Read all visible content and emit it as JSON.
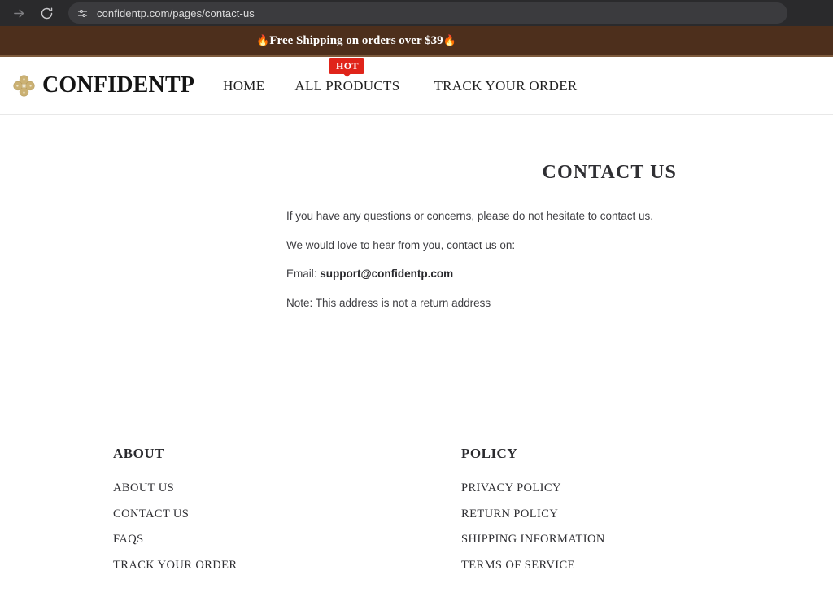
{
  "browser": {
    "forward_icon": "forward-arrow-icon",
    "reload_icon": "reload-icon",
    "omnibox": {
      "tune_icon": "tune-sliders-icon",
      "url": "confidentp.com/pages/contact-us"
    }
  },
  "announcement": {
    "flame_left": "🔥",
    "text": "Free Shipping on orders over $39",
    "flame_right": "🔥",
    "background_color": "#4d2f1c",
    "text_color": "#ffffff"
  },
  "header": {
    "logo": {
      "mark_icon": "quatrefoil-flower-logo-icon",
      "mark_color": "#cbb173",
      "name": "CONFIDENTP"
    },
    "nav": [
      {
        "label": "HOME"
      },
      {
        "label": "ALL PRODUCTS",
        "badge": "HOT",
        "badge_color": "#e0241a"
      },
      {
        "label": "TRACK YOUR ORDER"
      }
    ]
  },
  "main": {
    "title": "CONTACT US",
    "lines": [
      {
        "text": "If you have any questions or concerns, please do not hesitate to contact us."
      },
      {
        "text": "We would love to hear from you, contact us on:"
      },
      {
        "label": "Email: ",
        "value": "support@confidentp.com"
      },
      {
        "text": "Note: This address is not a return address"
      }
    ]
  },
  "footer": {
    "columns": [
      {
        "heading": "ABOUT",
        "links": [
          {
            "label": "ABOUT US"
          },
          {
            "label": "CONTACT US"
          },
          {
            "label": "FAQS"
          },
          {
            "label": "TRACK YOUR ORDER"
          }
        ]
      },
      {
        "heading": "POLICY",
        "links": [
          {
            "label": "PRIVACY POLICY"
          },
          {
            "label": "RETURN POLICY"
          },
          {
            "label": "SHIPPING INFORMATION"
          },
          {
            "label": "TERMS OF SERVICE"
          }
        ]
      }
    ]
  }
}
